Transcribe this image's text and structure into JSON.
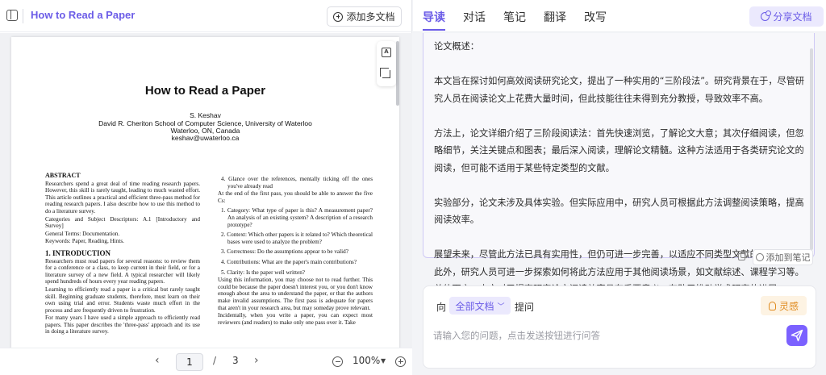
{
  "left_header": {
    "doc_title": "How to Read a Paper",
    "add_docs_label": "添加多文档"
  },
  "paper": {
    "title": "How to Read a Paper",
    "author": "S. Keshav",
    "affiliation": "David R. Cheriton School of Computer Science, University of Waterloo",
    "location": "Waterloo, ON, Canada",
    "email": "keshav@uwaterloo.ca",
    "abstract_heading": "ABSTRACT",
    "abstract_text": "Researchers spend a great deal of time reading research papers. However, this skill is rarely taught, leading to much wasted effort. This article outlines a practical and efficient three-pass method for reading research papers. I also describe how to use this method to do a literature survey.",
    "categories": "Categories and Subject Descriptors: A.1 [Introductory and Survey]",
    "general_terms": "General Terms: Documentation.",
    "keywords": "Keywords: Paper, Reading, Hints.",
    "intro_heading": "1.   INTRODUCTION",
    "intro_p1": "Researchers must read papers for several reasons: to review them for a conference or a class, to keep current in their field, or for a literature survey of a new field. A typical researcher will likely spend hundreds of hours every year reading papers.",
    "intro_p2": "Learning to efficiently read a paper is a critical but rarely taught skill. Beginning graduate students, therefore, must learn on their own using trial and error. Students waste much effort in the process and are frequently driven to frustration.",
    "intro_p3": "For many years I have used a simple approach to efficiently read papers. This paper describes the 'three-pass' approach and its use in doing a literature survey.",
    "right_item4": "4. Glance over the references, mentally ticking off the ones you've already read",
    "right_p1": "At the end of the first pass, you should be able to answer the five Cs:",
    "five_cs": [
      "1. Category: What type of paper is this? A measurement paper? An analysis of an existing system? A description of a research prototype?",
      "2. Context: Which other papers is it related to? Which theoretical bases were used to analyze the problem?",
      "3. Correctness: Do the assumptions appear to be valid?",
      "4. Contributions: What are the paper's main contributions?",
      "5. Clarity: Is the paper well written?"
    ],
    "right_p2": "Using this information, you may choose not to read further. This could be because the paper doesn't interest you, or you don't know enough about the area to understand the paper, or that the authors make invalid assumptions. The first pass is adequate for papers that aren't in your research area, but may someday prove relevant.",
    "right_p3": "Incidentally, when you write a paper, you can expect most reviewers (and readers) to make only one pass over it. Take"
  },
  "left_footer": {
    "current_page": "1",
    "page_separator": "/",
    "total_pages": "3",
    "zoom": "100%"
  },
  "tabs": [
    {
      "label": "导读"
    },
    {
      "label": "对话"
    },
    {
      "label": "笔记"
    },
    {
      "label": "翻译"
    },
    {
      "label": "改写"
    }
  ],
  "share_label": "分享文档",
  "summary": {
    "heading": "论文概述：",
    "paragraphs": [
      "本文旨在探讨如何高效阅读研究论文，提出了一种实用的“三阶段法”。研究背景在于，尽管研究人员在阅读论文上花费大量时间，但此技能往往未得到充分教授，导致效率不高。",
      "方法上，论文详细介绍了三阶段阅读法：首先快速浏览，了解论文大意；其次仔细阅读，但忽略细节，关注关键点和图表；最后深入阅读，理解论文精髓。这种方法适用于各类研究论文的阅读，但可能不适用于某些特定类型的文献。",
      "实验部分，论文未涉及具体实验。但实际应用中，研究人员可根据此方法调整阅读策略，提高阅读效率。",
      "展望未来，尽管此方法已具有实用性，但仍可进一步完善，以适应不同类型文献的阅读需求。此外，研究人员可进一步探索如何将此方法应用于其他阅读场景，如文献综述、课程学习等。总体而言，本文对于提高研究论文阅读效率具有重要意义，有助于推动学术研究的进展。"
    ],
    "add_note_label": "添加到笔记"
  },
  "qa": {
    "prefix": "向",
    "scope": "全部文档",
    "suffix": "提问",
    "inspire_label": "灵感",
    "placeholder": "请输入您的问题，点击发送按钮进行问答"
  },
  "colors": {
    "accent": "#6b5ce7",
    "accent_light": "#ebe9fd",
    "send_button": "#7b61ff",
    "inspire": "#e08a1e"
  }
}
